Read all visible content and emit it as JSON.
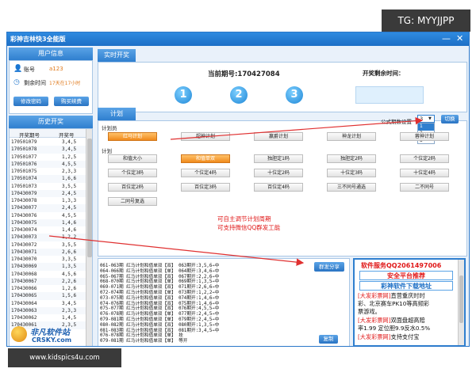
{
  "overlay": {
    "tg_label": "TG: MYYJJPP",
    "watermark_url": "www.kidspics4u.com",
    "site_logo_cn": "非凡软件站",
    "site_logo_en": "CRSKY.com"
  },
  "window": {
    "title": "彩神吉林快3全能版",
    "min_glyph": "—",
    "close_glyph": "✕"
  },
  "user_info": {
    "header": "用户信息",
    "account_label": "账号",
    "account_value": "a123",
    "time_label": "剩余时间",
    "time_value": "17天在17小时",
    "change_pwd_label": "修改密码",
    "renew_label": "购买续费"
  },
  "history": {
    "header": "历史开奖",
    "col_period": "开奖期号",
    "col_number": "开奖号",
    "rows": [
      [
        "170501079",
        "3,4,5"
      ],
      [
        "170501078",
        "3,4,5"
      ],
      [
        "170501077",
        "1,2,5"
      ],
      [
        "170501076",
        "4,5,5"
      ],
      [
        "170501075",
        "2,3,3"
      ],
      [
        "170501074",
        "1,6,6"
      ],
      [
        "170501073",
        "3,5,5"
      ],
      [
        "170430079",
        "2,4,5"
      ],
      [
        "170430078",
        "1,3,3"
      ],
      [
        "170430077",
        "2,4,5"
      ],
      [
        "170430076",
        "4,5,5"
      ],
      [
        "170430075",
        "1,4,6"
      ],
      [
        "170430074",
        "1,4,6"
      ],
      [
        "170430073",
        "1,2,2"
      ],
      [
        "170430072",
        "3,5,5"
      ],
      [
        "170430071",
        "2,6,6"
      ],
      [
        "170430070",
        "3,3,5"
      ],
      [
        "170430069",
        "1,3,5"
      ],
      [
        "170430068",
        "4,5,6"
      ],
      [
        "170430067",
        "2,2,6"
      ],
      [
        "170430066",
        "1,2,6"
      ],
      [
        "170430065",
        "1,5,6"
      ],
      [
        "170430064",
        "3,4,5"
      ],
      [
        "170430063",
        "2,3,3"
      ],
      [
        "170430062",
        "1,4,5"
      ],
      [
        "170430061",
        "2,3,5"
      ]
    ]
  },
  "realtime": {
    "tab": "实时开奖",
    "current_period_label": "当前期号:170427084",
    "countdown_label": "开奖剩余时间：",
    "countdown_value": "",
    "balls": [
      "1",
      "2",
      "3"
    ]
  },
  "plan": {
    "tab": "计划",
    "formula_label": "公式期数设置",
    "formula_value": "3",
    "formula_options": [
      "1",
      "2",
      "3"
    ],
    "switch_label": "切换",
    "planner_label": "计划员",
    "planner_buttons": [
      "红马计划",
      "超神计划",
      "赢爵计划",
      "神龙计划",
      "蓉神计划"
    ],
    "plan_label": "计划",
    "plan_buttons": [
      [
        "和值大小",
        "和值单双",
        "独胆定1码",
        "独胆定2码",
        "个位定2码"
      ],
      [
        "个位定3码",
        "个位定4码",
        "十位定2码",
        "十位定3码",
        "十位定4码"
      ],
      [
        "百位定2码",
        "百位定3码",
        "百位定4码",
        "三不同号通选",
        "二不同号"
      ],
      [
        "二同号复选"
      ]
    ],
    "annotation_1": "可自主调节计划周期",
    "annotation_2": "可支持微信QQ群发工能"
  },
  "records": {
    "lines": [
      "061-063期 红马计划和值单双【双】 063期开:3,5,6→中",
      "064-066期 红马计划和值单双【单】 064期开:3,4,6→中",
      "065-067期 红马计划和值单双【双】 067期开:2,2,6→中",
      "068-070期 红马计划和值单双【单】 069期开:1,3,5→中",
      "069-071期 红马计划和值单双【双】 071期开:2,6,6→中",
      "072-074期 红马计划和值单双【单】 073期开:1,2,2→中",
      "073-075期 红马计划和值单双【双】 074期开:1,4,6→中",
      "074-076期 红马计划和值单双【双】 075期开:1,4,6→中",
      "075-077期 红马计划和值单双【双】 076期开:4,5,5→中",
      "076-078期 红马计划和值单双【单】 077期开:2,4,5→中",
      "079-081期 红马计划和值单双【单】 079期开:2,4,5→中",
      "080-082期 红马计划和值单双【双】 080期开:1,3,5→中",
      "081-083期 红马计划和值单双【双】 081期开:3,4,5→中",
      "076-078期 红马计划和值单双【单】 挂",
      "079-081期 红马计划和值单双【单】 等开"
    ],
    "share_label": "群发分享",
    "copy_label": "复制"
  },
  "ad": {
    "service": "软件服务QQ2061497006",
    "recommend": "安全平台推荐",
    "download": "彩神软件下载地址",
    "p1_tag": "[大发彩票网]",
    "p1_l1": "直营重庆时时",
    "p1_l2": "彩、北京赛车PK10等高频彩",
    "p1_l3": "票游戏。",
    "p2_tag": "[大发彩票网]",
    "p2_l1": "双面盘超高赔",
    "p2_l2": "率1.99 定位胆9.9反水0.5%",
    "p3_tag": "[大发彩票网]",
    "p3_l1": "支持支付宝"
  },
  "colors": {
    "accent": "#2f7fcf",
    "active_button": "#f08a1c",
    "annotation": "#e01818",
    "arrow": "#e03030"
  }
}
